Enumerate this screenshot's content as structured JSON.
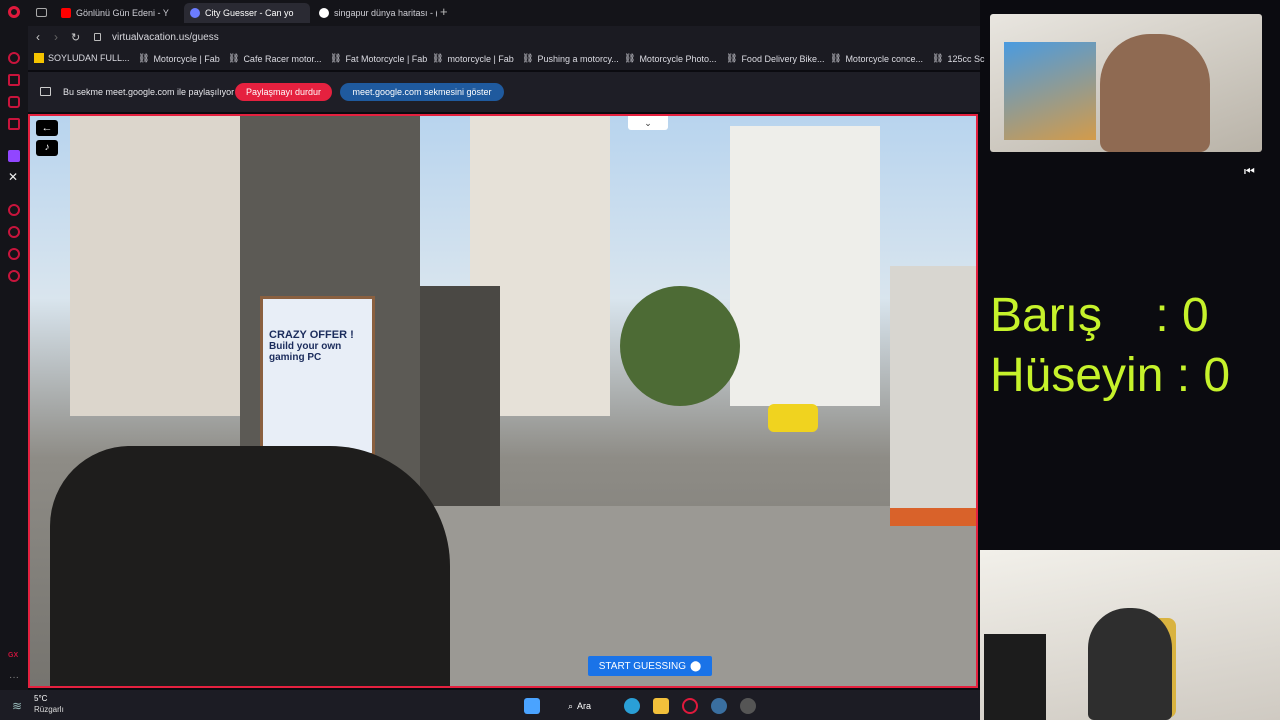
{
  "browser": {
    "tabs": [
      {
        "label": "Gönlünü Gün Edeni - Y",
        "favicon_color": "#ff0000"
      },
      {
        "label": "City Guesser - Can yo",
        "favicon_color": "#6b7cff"
      },
      {
        "label": "singapur dünya haritası - (",
        "favicon_color": "#ffffff"
      }
    ],
    "new_tab_label": "+",
    "url": "virtualvacation.us/guess",
    "bookmarks": [
      "SOYLUDAN FULL...",
      "Motorcycle | Fab",
      "Cafe Racer motor...",
      "Fat Motorcycle | Fab",
      "motorcycle | Fab",
      "Pushing a motorcy...",
      "Motorcycle Photo...",
      "Food Delivery Bike...",
      "Motorcycle conce...",
      "125cc Sc"
    ],
    "accent_color": "#e5213f"
  },
  "share_bar": {
    "message": "Bu sekme meet.google.com ile paylaşılıyor",
    "stop_button": "Paylaşmayı durdur",
    "show_tab_button": "meet.google.com sekmesini göster"
  },
  "game": {
    "start_guessing_label": "START GUESSING",
    "button_color": "#1a73e8",
    "sign_lines": [
      "CRAZY OFFER !",
      "Build your own",
      "gaming PC"
    ]
  },
  "scoreboard": {
    "row1": "Barış    : 0",
    "row2": "Hüseyin : 0",
    "color": "#c6f22b"
  },
  "taskbar": {
    "weather_temp": "5°C",
    "weather_desc": "Rüzgarlı",
    "search_label": "Ara",
    "gx_label": "GX"
  }
}
